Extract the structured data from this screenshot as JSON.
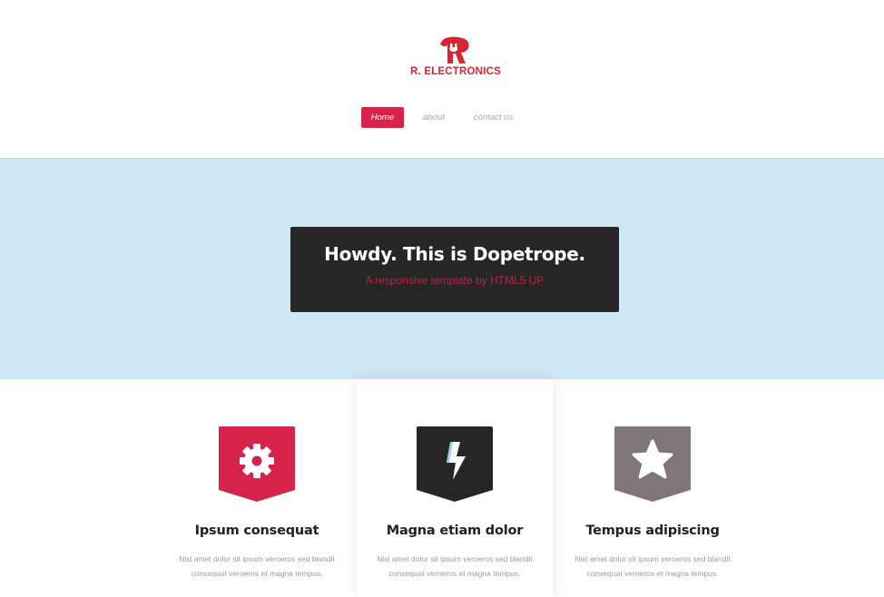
{
  "header": {
    "logo_text": "R. ELECTRONICS",
    "brand_color": "#d62631",
    "logo_icon": "plug-logo-icon"
  },
  "nav": {
    "items": [
      {
        "label": "Home",
        "active": true
      },
      {
        "label": "about",
        "active": false
      },
      {
        "label": "contact us",
        "active": false
      }
    ],
    "active_color": "#d52349"
  },
  "banner": {
    "title": "Howdy. This is Dopetrope.",
    "subtitle": "A responsive template by HTML5 UP",
    "background": "#cde7f4",
    "box_color": "#272526"
  },
  "features": [
    {
      "icon": "gear-icon",
      "badge_color": "#d52349",
      "title": "Ipsum consequat",
      "text": "Nisl amet dolor sit ipsum veroeros sed blandit consequat veroeros et magna tempus."
    },
    {
      "icon": "bolt-icon",
      "badge_color": "#272526",
      "title": "Magna etiam dolor",
      "text": "Nisl amet dolor sit ipsum veroeros sed blandit consequat veroeros et magna tempus."
    },
    {
      "icon": "star-icon",
      "badge_color": "#7f7677",
      "title": "Tempus adipiscing",
      "text": "Nisl amet dolor sit ipsum veroeros sed blandit consequat veroeros et magna tempus."
    }
  ]
}
